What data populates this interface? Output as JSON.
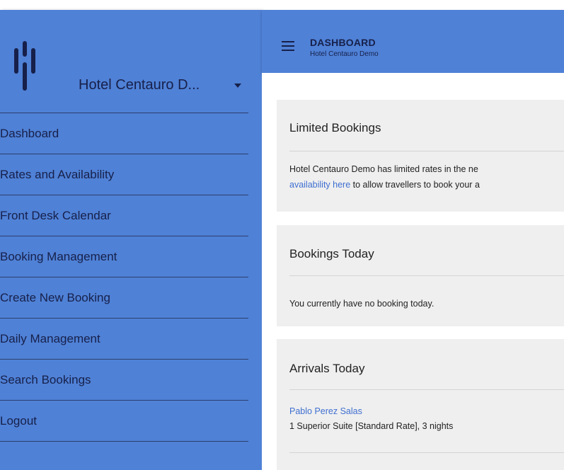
{
  "sidebar": {
    "hotel_name": "Hotel Centauro D...",
    "nav": [
      "Dashboard",
      "Rates and Availability",
      "Front Desk Calendar",
      "Booking Management",
      "Create New Booking",
      "Daily Management",
      "Search Bookings",
      "Logout"
    ]
  },
  "header": {
    "title": "DASHBOARD",
    "subtitle": "Hotel Centauro Demo"
  },
  "cards": {
    "limited": {
      "title": "Limited Bookings",
      "text1": "Hotel Centauro Demo has limited rates in the ne",
      "link_text": "availability here",
      "text2": " to allow travellers to book your a"
    },
    "today": {
      "title": "Bookings Today",
      "text": "You currently have no booking today."
    },
    "arrivals": {
      "title": "Arrivals Today",
      "guest": "Pablo Perez Salas",
      "details": "1 Superior Suite [Standard Rate], 3 nights"
    }
  },
  "colors": {
    "primary": "#4f81d6",
    "text_dark": "#17204a",
    "card_bg": "#efefef",
    "link": "#3f6fd0"
  }
}
